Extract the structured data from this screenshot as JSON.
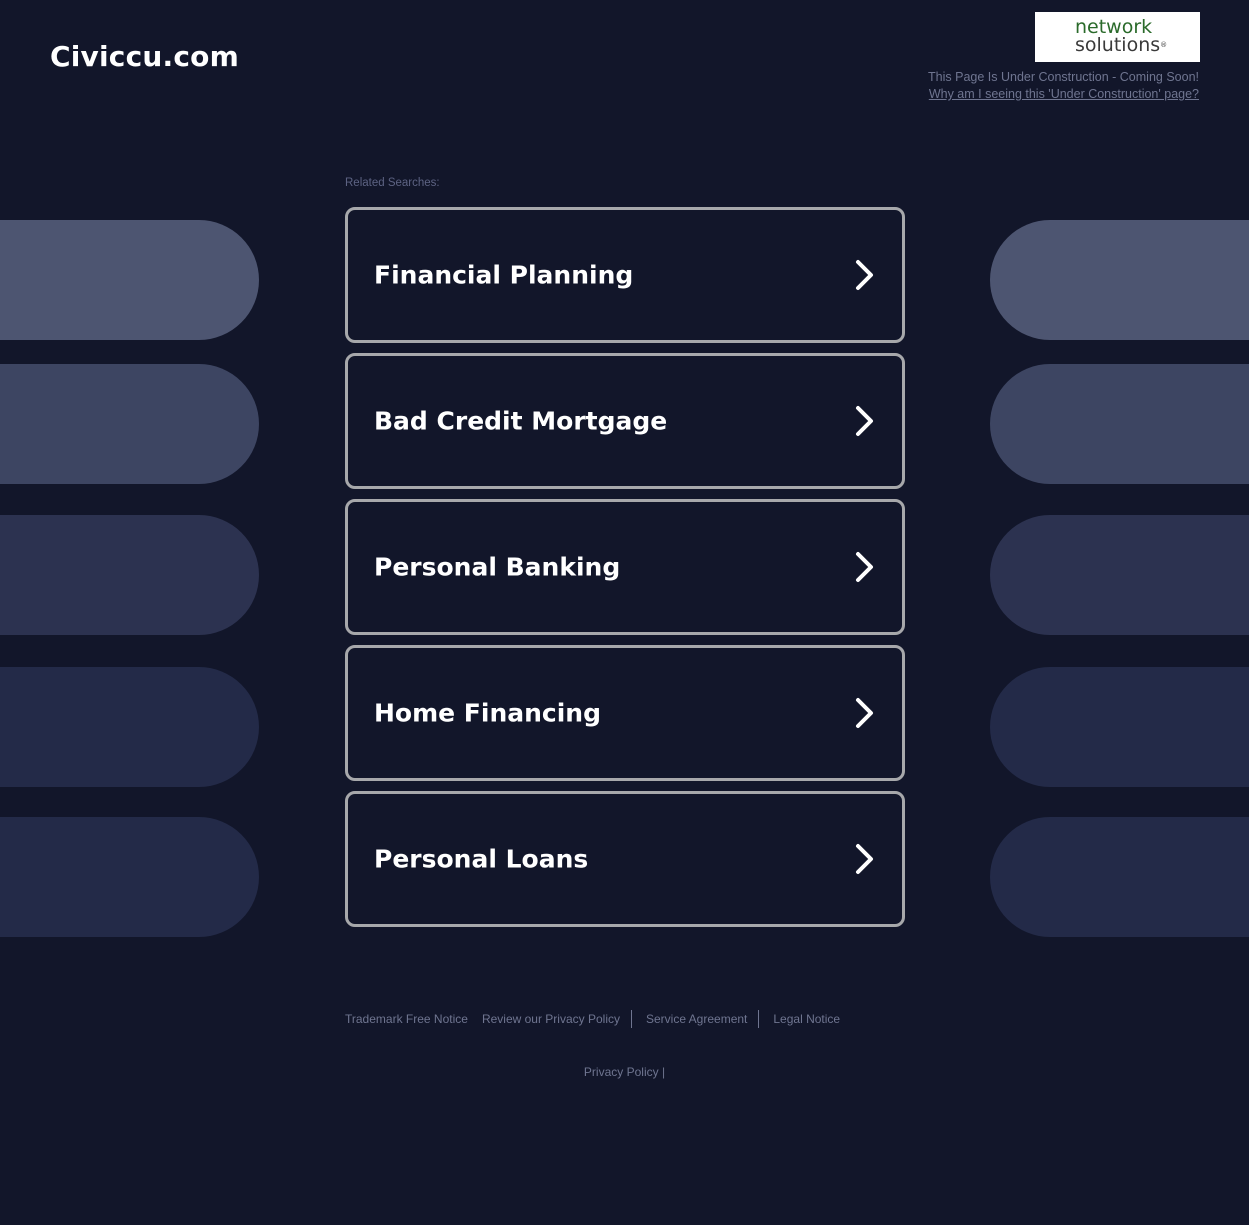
{
  "header": {
    "site_title": "Civiccu.com",
    "logo": {
      "line1": "network",
      "line2": "solutions",
      "mark": "®"
    },
    "under_construction_text": "This Page Is Under Construction - Coming Soon!",
    "why_link": "Why am I seeing this 'Under Construction' page?"
  },
  "related": {
    "label": "Related Searches:",
    "items": [
      {
        "label": "Financial Planning"
      },
      {
        "label": "Bad Credit Mortgage"
      },
      {
        "label": "Personal Banking"
      },
      {
        "label": "Home Financing"
      },
      {
        "label": "Personal Loans"
      }
    ]
  },
  "footer": {
    "links": [
      "Trademark Free Notice",
      "Review our Privacy Policy",
      "Service Agreement",
      "Legal Notice"
    ],
    "privacy_policy": "Privacy Policy |"
  },
  "colors": {
    "background": "#12162a",
    "button_border": "#a7a8ab",
    "muted_text": "#6f7590",
    "logo_green": "#2a6a2a"
  },
  "icons": {
    "button_arrow": "chevron-right-icon"
  }
}
